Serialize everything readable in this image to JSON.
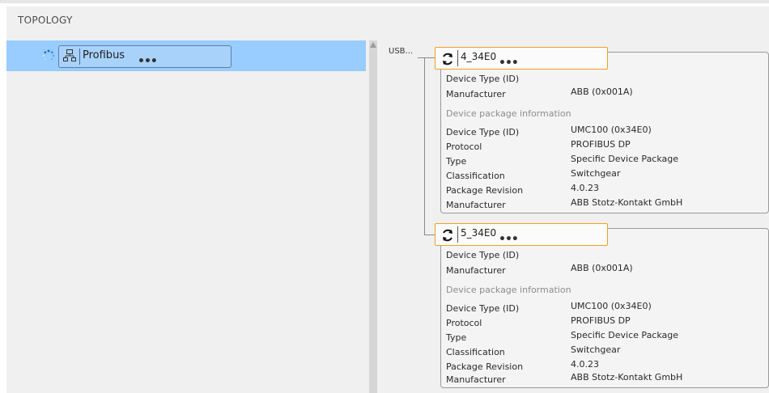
{
  "panel": {
    "title": "TOPOLOGY"
  },
  "tree": {
    "node": {
      "label": "Profibus",
      "more": "•••",
      "icon": "network-icon",
      "status_icon": "loading-spinner-icon"
    }
  },
  "topology": {
    "connector_label": "USB...",
    "devices": [
      {
        "name": "4_34E0",
        "more": "•••",
        "icon": "refresh-cycle-icon",
        "rows": [
          {
            "key": "Device Type (ID)",
            "value": ""
          },
          {
            "key": "Manufacturer",
            "value": "ABB (0x001A)"
          }
        ],
        "section_title": "Device package information",
        "package_rows": [
          {
            "key": "Device Type (ID)",
            "value": "UMC100 (0x34E0)"
          },
          {
            "key": "Protocol",
            "value": "PROFIBUS DP"
          },
          {
            "key": "Type",
            "value": "Specific Device Package"
          },
          {
            "key": "Classification",
            "value": "Switchgear"
          },
          {
            "key": "Package Revision",
            "value": "4.0.23"
          },
          {
            "key": "Manufacturer",
            "value": "ABB Stotz-Kontakt GmbH"
          }
        ]
      },
      {
        "name": "5_34E0",
        "more": "•••",
        "icon": "refresh-cycle-icon",
        "rows": [
          {
            "key": "Device Type (ID)",
            "value": ""
          },
          {
            "key": "Manufacturer",
            "value": "ABB (0x001A)"
          }
        ],
        "section_title": "Device package information",
        "package_rows": [
          {
            "key": "Device Type (ID)",
            "value": "UMC100 (0x34E0)"
          },
          {
            "key": "Protocol",
            "value": "PROFIBUS DP"
          },
          {
            "key": "Type",
            "value": "Specific Device Package"
          },
          {
            "key": "Classification",
            "value": "Switchgear"
          },
          {
            "key": "Package Revision",
            "value": "4.0.23"
          },
          {
            "key": "Manufacturer",
            "value": "ABB Stotz-Kontakt GmbH"
          }
        ]
      }
    ]
  },
  "colors": {
    "selection": "#99ccff",
    "device_border_accent": "#f0a020",
    "panel_background": "#f0f0f0"
  }
}
